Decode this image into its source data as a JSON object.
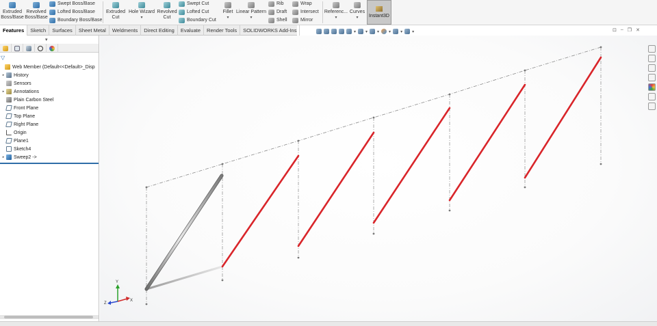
{
  "ribbon": {
    "extruded_boss": [
      "Extruded",
      "Boss/Base"
    ],
    "revolved_boss": [
      "Revolved",
      "Boss/Base"
    ],
    "swept_boss": "Swept Boss/Base",
    "lofted_boss": "Lofted Boss/Base",
    "boundary_boss": "Boundary Boss/Base",
    "extruded_cut": [
      "Extruded",
      "Cut"
    ],
    "hole_wizard": "Hole Wizard",
    "revolved_cut": [
      "Revolved",
      "Cut"
    ],
    "swept_cut": "Swept Cut",
    "lofted_cut": "Lofted Cut",
    "boundary_cut": "Boundary Cut",
    "fillet": "Fillet",
    "linear_pattern": "Linear Pattern",
    "rib": "Rib",
    "draft": "Draft",
    "shell": "Shell",
    "wrap": "Wrap",
    "intersect": "Intersect",
    "mirror": "Mirror",
    "reference": "Referenc...",
    "curves": "Curves",
    "instant3d": "Instant3D"
  },
  "tabs": [
    "Features",
    "Sketch",
    "Surfaces",
    "Sheet Metal",
    "Weldments",
    "Direct Editing",
    "Evaluate",
    "Render Tools",
    "SOLIDWORKS Add-Ins"
  ],
  "active_tab": "Features",
  "feature_tree": {
    "root": "Web Member  (Default<<Default>_Disp",
    "items": [
      {
        "label": "History",
        "icon": "history-icon",
        "arrow": "▸"
      },
      {
        "label": "Sensors",
        "icon": "sensors-icon",
        "arrow": ""
      },
      {
        "label": "Annotations",
        "icon": "annotations-icon",
        "arrow": "▸"
      },
      {
        "label": "Plain Carbon Steel",
        "icon": "material-icon",
        "arrow": ""
      },
      {
        "label": "Front Plane",
        "icon": "plane-icon",
        "arrow": ""
      },
      {
        "label": "Top Plane",
        "icon": "plane-icon",
        "arrow": ""
      },
      {
        "label": "Right Plane",
        "icon": "plane-icon",
        "arrow": ""
      },
      {
        "label": "Origin",
        "icon": "origin-icon",
        "arrow": ""
      },
      {
        "label": "Plane1",
        "icon": "plane-icon",
        "arrow": ""
      },
      {
        "label": "Sketch4",
        "icon": "sketch-icon",
        "arrow": ""
      },
      {
        "label": "Sweep2 ->",
        "icon": "sweep-icon",
        "arrow": "▸"
      }
    ]
  },
  "colors": {
    "sketch_red": "#d9252a",
    "construction_gray": "#8a8a8a",
    "accent_blue": "#2f6ea8"
  },
  "triad": {
    "x": "X",
    "y": "Y",
    "z": "Z"
  }
}
